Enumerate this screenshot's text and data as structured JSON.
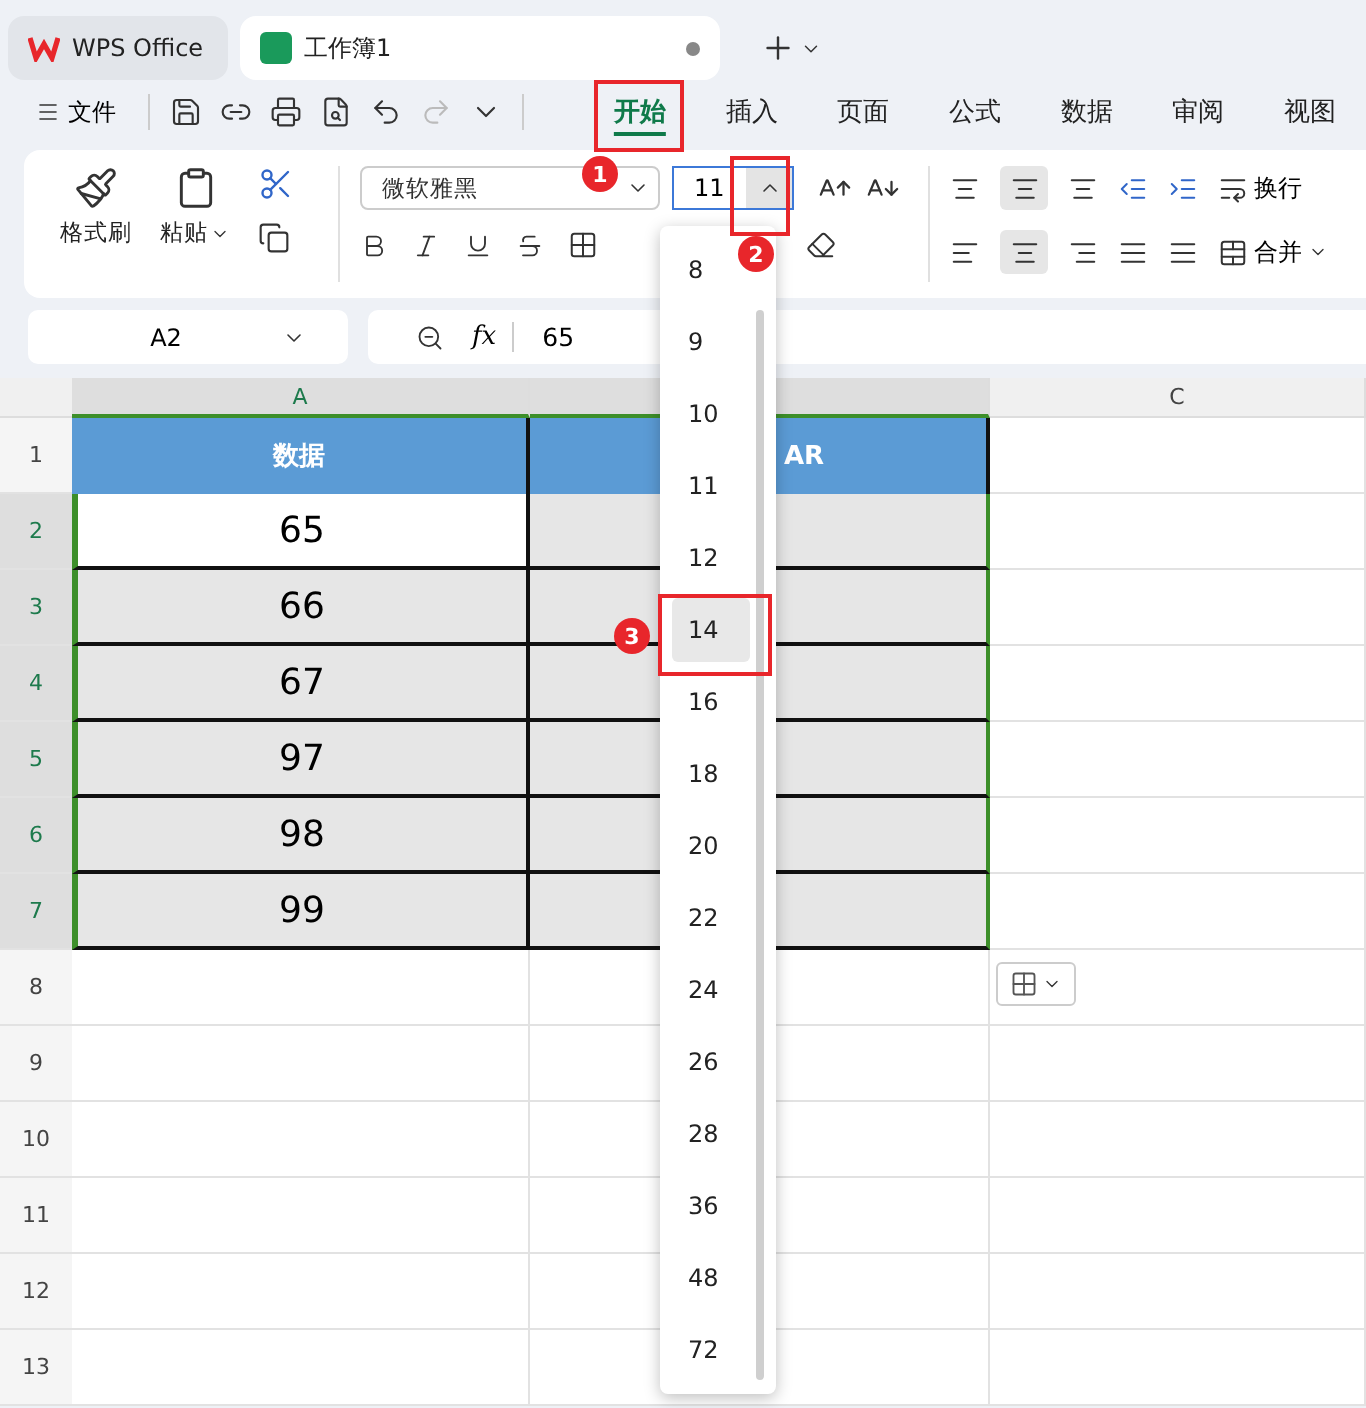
{
  "tabs": [
    {
      "label": "WPS Office",
      "kind": "home",
      "selected": false
    },
    {
      "label": "工作簿1",
      "kind": "sheet",
      "selected": true
    }
  ],
  "menu": {
    "file": "文件",
    "tabs": [
      {
        "label": "开始",
        "selected": true
      },
      {
        "label": "插入",
        "selected": false
      },
      {
        "label": "页面",
        "selected": false
      },
      {
        "label": "公式",
        "selected": false
      },
      {
        "label": "数据",
        "selected": false
      },
      {
        "label": "审阅",
        "selected": false
      },
      {
        "label": "视图",
        "selected": false
      }
    ]
  },
  "ribbon": {
    "format_painter": "格式刷",
    "paste": "粘贴",
    "font": "微软雅黑",
    "size": "11",
    "wrap": "换行",
    "merge": "合并"
  },
  "formula_bar": {
    "cell": "A2",
    "fx": "fx",
    "value": "65"
  },
  "columns": {
    "a": "A",
    "c": "C"
  },
  "rows": [
    {
      "number": "1",
      "kind": "header",
      "selected": false,
      "a": "数据",
      "b": "AR"
    },
    {
      "number": "2",
      "kind": "data",
      "selected": true,
      "active": true,
      "a": "65"
    },
    {
      "number": "3",
      "kind": "data",
      "selected": true,
      "active": false,
      "a": "66"
    },
    {
      "number": "4",
      "kind": "data",
      "selected": true,
      "active": false,
      "a": "67"
    },
    {
      "number": "5",
      "kind": "data",
      "selected": true,
      "active": false,
      "a": "97"
    },
    {
      "number": "6",
      "kind": "data",
      "selected": true,
      "active": false,
      "a": "98"
    },
    {
      "number": "7",
      "kind": "data",
      "selected": true,
      "active": false,
      "a": "99"
    },
    {
      "number": "8",
      "kind": "empty",
      "selected": false
    },
    {
      "number": "9",
      "kind": "empty",
      "selected": false
    },
    {
      "number": "10",
      "kind": "empty",
      "selected": false
    },
    {
      "number": "11",
      "kind": "empty",
      "selected": false
    },
    {
      "number": "12",
      "kind": "empty",
      "selected": false
    },
    {
      "number": "13",
      "kind": "empty",
      "selected": false
    }
  ],
  "size_dropdown": [
    {
      "label": "8",
      "selected": false
    },
    {
      "label": "9",
      "selected": false
    },
    {
      "label": "10",
      "selected": false
    },
    {
      "label": "11",
      "selected": false
    },
    {
      "label": "12",
      "selected": false
    },
    {
      "label": "14",
      "selected": true
    },
    {
      "label": "16",
      "selected": false
    },
    {
      "label": "18",
      "selected": false
    },
    {
      "label": "20",
      "selected": false
    },
    {
      "label": "22",
      "selected": false
    },
    {
      "label": "24",
      "selected": false
    },
    {
      "label": "26",
      "selected": false
    },
    {
      "label": "28",
      "selected": false
    },
    {
      "label": "36",
      "selected": false
    },
    {
      "label": "48",
      "selected": false
    },
    {
      "label": "72",
      "selected": false
    }
  ],
  "annotations": [
    {
      "number": "1"
    },
    {
      "number": "2"
    },
    {
      "number": "3"
    }
  ]
}
